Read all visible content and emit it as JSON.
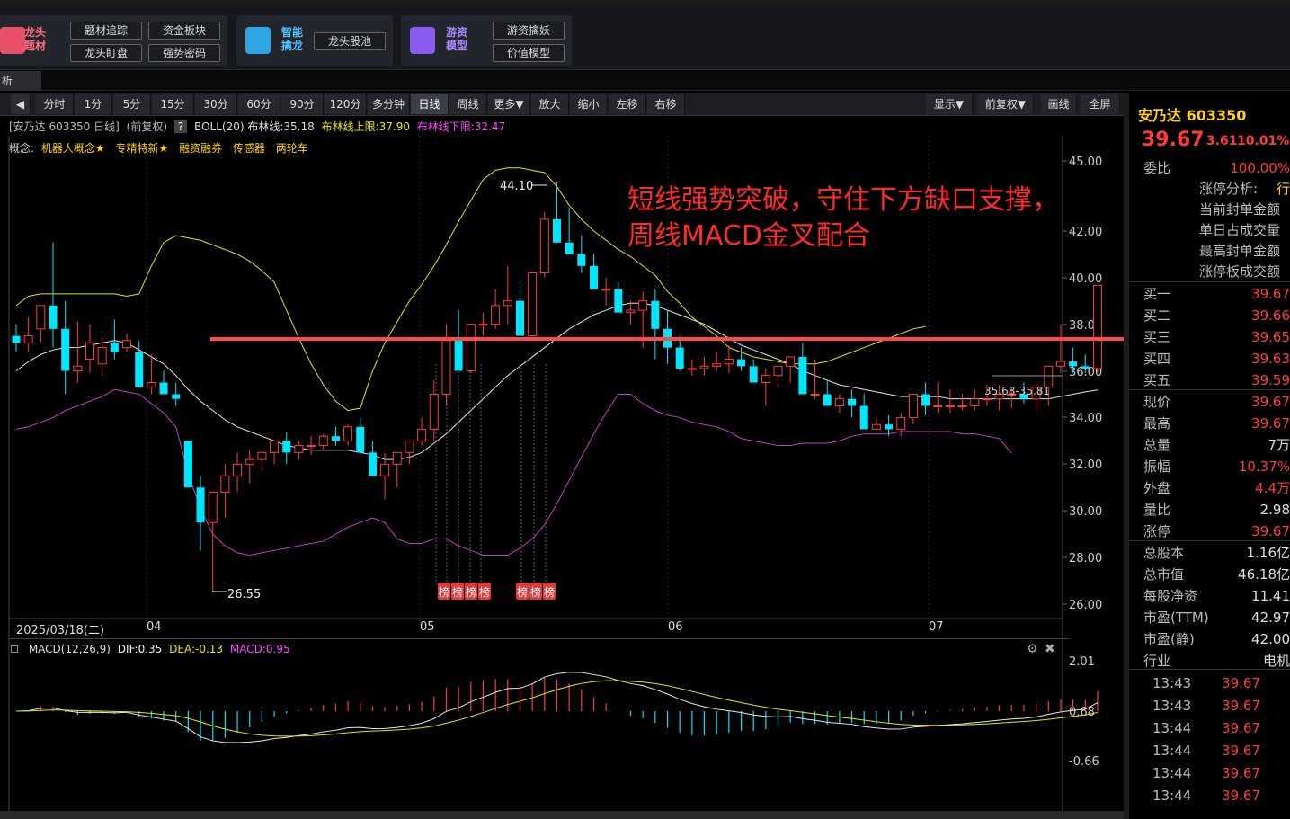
{
  "toolbar": {
    "group1_title": "龙头题材",
    "group1_buttons": [
      "题材追踪",
      "资金板块",
      "龙头盯盘",
      "强势密码"
    ],
    "group2_title": "智能擒龙",
    "group2_buttons": [
      "龙头股池"
    ],
    "group3_title": "游资模型",
    "group3_buttons": [
      "游资擒妖",
      "价值模型"
    ]
  },
  "analysis_tab": "析",
  "period_bar": {
    "buttons": [
      "分时",
      "1分",
      "5分",
      "15分",
      "30分",
      "60分",
      "90分",
      "120分",
      "多分钟",
      "日线",
      "周线",
      "更多▼",
      "放大",
      "缩小",
      "左移",
      "右移"
    ],
    "active": "日线",
    "right_buttons": [
      "显示▼",
      "前复权▼",
      "画线",
      "全屏"
    ]
  },
  "chart_info": {
    "stock": "[安乃达 603350 日线]",
    "adjust": "(前复权)",
    "help": "?",
    "boll": "BOLL(20) 布林线:35.18",
    "upper": "布林线上限:37.90",
    "lower": "布林线下限:32.47"
  },
  "concepts": {
    "label": "概念:",
    "items": [
      "机器人概念★",
      "专精特新★",
      "融资融券",
      "传感器",
      "两轮车"
    ]
  },
  "annotation": {
    "line1": "短线强势突破，守住下方缺口支撑，",
    "line2": "周线MACD金叉配合"
  },
  "colors": {
    "up": "#ff3b3b",
    "down": "#00e6ff",
    "boll_mid": "#e6e6e6",
    "boll_upper": "#e6e600",
    "boll_lower": "#c040c0",
    "support_line": "#ff4a4a",
    "badge": "#e23a3a"
  },
  "price_axis": [
    "45.00",
    "42.00",
    "40.00",
    "38.00",
    "36.00",
    "34.00",
    "32.00",
    "30.00",
    "28.00",
    "26.00"
  ],
  "marks": {
    "high": "44.10",
    "low": "26.55",
    "range": "35.68-35.81"
  },
  "badges": [
    "榜",
    "榜",
    "榜",
    "榜",
    "榜",
    "榜",
    "榜"
  ],
  "date_axis": {
    "cursor_date": "2025/03/18(二)",
    "months": [
      "04",
      "05",
      "06",
      "07"
    ]
  },
  "macd": {
    "title": "MACD(12,26,9)",
    "dif": "DIF:0.35",
    "dea": "DEA:-0.13",
    "macd": "MACD:0.95",
    "axis": [
      "2.01",
      "0.68",
      "-0.66"
    ]
  },
  "right_panel": {
    "name": "安乃达 603350",
    "price": "39.67",
    "change": "3.61",
    "change_pct": "10.01%",
    "rows": [
      {
        "label": "委比",
        "value": "100.00%",
        "color": "red"
      },
      {
        "label": "涨停分析:",
        "value": "行",
        "color": "yellow"
      },
      {
        "label": "当前封单金额",
        "value": "",
        "color": "white"
      },
      {
        "label": "单日占成交量",
        "value": "",
        "color": "white"
      },
      {
        "label": "最高封单金额",
        "value": "",
        "color": "white"
      },
      {
        "label": "涨停板成交额",
        "value": "",
        "color": "white"
      }
    ],
    "order_book": [
      {
        "label": "买一",
        "value": "39.67"
      },
      {
        "label": "买二",
        "value": "39.66"
      },
      {
        "label": "买三",
        "value": "39.65"
      },
      {
        "label": "买四",
        "value": "39.63"
      },
      {
        "label": "买五",
        "value": "39.59"
      }
    ],
    "quote": [
      {
        "label": "现价",
        "value": "39.67",
        "color": "red"
      },
      {
        "label": "最高",
        "value": "39.67",
        "color": "red"
      },
      {
        "label": "总量",
        "value": "7万",
        "color": "white"
      },
      {
        "label": "振幅",
        "value": "10.37%",
        "color": "red"
      },
      {
        "label": "外盘",
        "value": "4.4万",
        "color": "red"
      },
      {
        "label": "量比",
        "value": "2.98",
        "color": "white"
      },
      {
        "label": "涨停",
        "value": "39.67",
        "color": "red"
      }
    ],
    "fundamentals": [
      {
        "label": "总股本",
        "value": "1.16亿"
      },
      {
        "label": "总市值",
        "value": "46.18亿"
      },
      {
        "label": "每股净资",
        "value": "11.41"
      },
      {
        "label": "市盈(TTM)",
        "value": "42.97"
      },
      {
        "label": "市盈(静)",
        "value": "42.00"
      },
      {
        "label": "行业",
        "value": "电机"
      }
    ],
    "ticks": [
      {
        "time": "13:43",
        "price": "39.67"
      },
      {
        "time": "13:43",
        "price": "39.67"
      },
      {
        "time": "13:44",
        "price": "39.67"
      },
      {
        "time": "13:44",
        "price": "39.67"
      },
      {
        "time": "13:44",
        "price": "39.67"
      },
      {
        "time": "13:44",
        "price": "39.67"
      }
    ]
  },
  "chart_data": {
    "type": "candlestick",
    "ylim": [
      25.5,
      45.5
    ],
    "open": [
      37.5,
      37.2,
      37.8,
      38.8,
      37.8,
      36.0,
      36.5,
      36.3,
      37.2,
      37.0,
      36.8,
      35.3,
      35.5,
      35.0,
      33.0,
      31.0,
      29.5,
      30.8,
      31.5,
      32.0,
      32.2,
      32.5,
      33.0,
      32.5,
      32.8,
      32.8,
      33.2,
      33.0,
      33.6,
      32.5,
      31.5,
      32.0,
      32.5,
      33.0,
      33.5,
      35.0,
      37.3,
      36.0,
      38.0,
      38.0,
      38.8,
      39.0,
      37.5,
      40.2,
      42.5,
      41.5,
      41.0,
      40.5,
      39.5,
      39.5,
      38.5,
      38.6,
      39.0,
      37.8,
      37.0,
      36.1,
      36.1,
      36.2,
      36.3,
      36.5,
      36.2,
      35.5,
      35.8,
      36.2,
      36.6,
      35.0,
      35.0,
      34.5,
      34.8,
      34.5,
      33.5,
      33.7,
      33.5,
      34.0,
      35.0,
      34.5,
      34.5,
      34.5,
      34.5,
      34.8,
      34.8,
      35.0,
      35.0,
      34.8,
      35.3,
      36.2,
      36.4,
      36.2,
      36.1
    ],
    "high": [
      38.0,
      38.3,
      38.5,
      41.5,
      39.0,
      38.1,
      38.0,
      37.5,
      38.2,
      37.6,
      37.3,
      36.7,
      36.0,
      35.5,
      33.0,
      31.5,
      30.5,
      32.0,
      32.5,
      32.6,
      32.6,
      32.8,
      33.4,
      33.0,
      33.2,
      33.3,
      33.6,
      33.7,
      34.0,
      33.0,
      32.5,
      32.5,
      33.0,
      34.0,
      35.6,
      38.0,
      38.6,
      37.2,
      38.5,
      39.5,
      40.5,
      39.8,
      38.5,
      42.8,
      44.1,
      43.0,
      41.8,
      41.0,
      40.0,
      39.8,
      39.0,
      39.4,
      39.5,
      38.6,
      37.5,
      36.5,
      36.6,
      36.8,
      37.1,
      37.0,
      36.5,
      36.1,
      36.2,
      36.5,
      37.2,
      36.5,
      35.6,
      35.0,
      35.2,
      35.0,
      34.0,
      34.1,
      34.2,
      35.0,
      35.5,
      35.5,
      35.2,
      35.0,
      35.2,
      35.4,
      35.4,
      35.3,
      35.5,
      35.5,
      36.0,
      38.0,
      37.0,
      36.7,
      39.67
    ],
    "low": [
      36.8,
      36.8,
      37.2,
      37.0,
      35.0,
      35.5,
      35.9,
      35.8,
      36.5,
      36.8,
      35.3,
      35.0,
      35.0,
      34.5,
      31.0,
      28.3,
      26.55,
      29.7,
      30.8,
      31.2,
      31.7,
      32.0,
      32.0,
      32.2,
      32.4,
      32.6,
      32.8,
      32.8,
      33.1,
      31.5,
      30.5,
      31.0,
      32.0,
      32.8,
      33.0,
      34.5,
      36.8,
      35.9,
      37.5,
      37.8,
      38.0,
      37.5,
      37.5,
      40.0,
      41.5,
      41.0,
      40.2,
      39.5,
      38.8,
      38.5,
      38.0,
      37.0,
      36.5,
      36.3,
      36.0,
      35.8,
      35.8,
      36.0,
      35.9,
      36.0,
      35.5,
      34.5,
      35.3,
      35.5,
      35.8,
      34.8,
      34.5,
      34.2,
      34.0,
      33.5,
      33.5,
      33.2,
      33.2,
      33.7,
      34.1,
      34.2,
      34.2,
      34.3,
      34.3,
      34.5,
      34.3,
      34.4,
      34.6,
      34.3,
      34.5,
      35.9,
      35.9,
      35.9,
      35.9
    ],
    "close": [
      37.2,
      37.5,
      38.8,
      37.8,
      36.0,
      36.2,
      37.2,
      37.0,
      36.8,
      37.3,
      35.3,
      35.5,
      35.0,
      34.8,
      31.0,
      29.5,
      30.8,
      31.5,
      32.0,
      32.2,
      32.5,
      33.0,
      32.5,
      32.8,
      32.8,
      33.2,
      33.0,
      33.6,
      32.5,
      31.5,
      32.0,
      32.5,
      33.0,
      33.5,
      35.0,
      37.3,
      36.0,
      38.0,
      38.0,
      38.8,
      39.0,
      37.5,
      40.2,
      42.5,
      41.5,
      41.0,
      40.5,
      39.5,
      39.5,
      38.5,
      38.6,
      39.0,
      37.8,
      37.0,
      36.1,
      36.1,
      36.2,
      36.3,
      36.5,
      36.2,
      35.5,
      35.8,
      36.2,
      36.6,
      35.0,
      35.0,
      34.5,
      34.8,
      34.5,
      33.5,
      33.7,
      33.5,
      34.0,
      35.0,
      34.5,
      34.5,
      34.5,
      34.5,
      34.8,
      34.8,
      35.0,
      35.0,
      34.8,
      35.3,
      36.2,
      36.4,
      36.2,
      36.1,
      39.67
    ],
    "boll_mid": [
      36.0,
      36.4,
      36.7,
      36.9,
      37.0,
      37.0,
      37.1,
      37.2,
      37.3,
      37.2,
      36.9,
      36.6,
      36.3,
      35.8,
      35.2,
      34.7,
      34.3,
      33.9,
      33.6,
      33.4,
      33.2,
      33.0,
      32.8,
      32.7,
      32.6,
      32.6,
      32.6,
      32.6,
      32.5,
      32.4,
      32.2,
      32.2,
      32.3,
      32.5,
      32.9,
      33.3,
      33.8,
      34.3,
      34.8,
      35.3,
      35.8,
      36.2,
      36.6,
      37.0,
      37.4,
      37.8,
      38.1,
      38.4,
      38.6,
      38.8,
      38.9,
      38.9,
      38.8,
      38.6,
      38.4,
      38.2,
      38.0,
      37.7,
      37.4,
      37.1,
      36.9,
      36.7,
      36.5,
      36.3,
      36.0,
      35.8,
      35.6,
      35.4,
      35.3,
      35.2,
      35.1,
      35.0,
      34.9,
      34.9,
      34.9,
      34.9,
      34.8,
      34.8,
      34.8,
      34.8,
      34.8,
      34.8,
      34.8,
      34.8,
      34.8,
      34.9,
      35.0,
      35.1,
      35.18
    ],
    "boll_upper": [
      38.8,
      39.2,
      39.3,
      39.3,
      39.3,
      39.3,
      39.3,
      39.3,
      39.3,
      39.2,
      39.3,
      40.5,
      41.5,
      41.8,
      41.7,
      41.6,
      41.4,
      41.2,
      41.0,
      40.7,
      40.3,
      39.8,
      38.6,
      37.4,
      36.3,
      35.4,
      34.7,
      34.3,
      34.4,
      36.0,
      37.2,
      38.1,
      39.0,
      39.7,
      40.5,
      41.4,
      42.4,
      43.3,
      44.2,
      44.6,
      44.7,
      44.7,
      44.6,
      44.5,
      43.9,
      43.1,
      42.5,
      42.0,
      41.6,
      41.2,
      40.9,
      40.5,
      40.1,
      39.4,
      38.9,
      38.3,
      37.9,
      37.5,
      37.0,
      36.8,
      36.6,
      36.5,
      36.4,
      36.3,
      36.3,
      36.3,
      36.4,
      36.6,
      36.8,
      37.0,
      37.2,
      37.4,
      37.6,
      37.8,
      37.9
    ],
    "boll_lower": [
      33.5,
      33.6,
      33.8,
      34.0,
      34.3,
      34.5,
      34.7,
      34.9,
      35.2,
      35.1,
      35.0,
      34.6,
      34.2,
      33.6,
      31.6,
      30.1,
      29.0,
      28.5,
      28.2,
      28.1,
      28.2,
      28.3,
      28.4,
      28.5,
      28.6,
      28.7,
      29.0,
      29.3,
      29.5,
      29.7,
      29.5,
      28.8,
      28.6,
      28.6,
      28.8,
      28.8,
      28.5,
      28.3,
      28.1,
      28.1,
      28.1,
      28.4,
      28.8,
      29.4,
      30.3,
      31.3,
      32.3,
      33.3,
      34.2,
      35.0,
      35.0,
      34.6,
      34.3,
      34.1,
      34.0,
      33.8,
      33.7,
      33.6,
      33.4,
      33.1,
      33.0,
      32.9,
      32.8,
      32.8,
      32.9,
      32.9,
      32.9,
      33.0,
      33.2,
      33.3,
      33.3,
      33.3,
      33.4,
      33.4,
      33.4,
      33.4,
      33.4,
      33.3,
      33.3,
      33.2,
      33.1,
      32.47
    ]
  }
}
